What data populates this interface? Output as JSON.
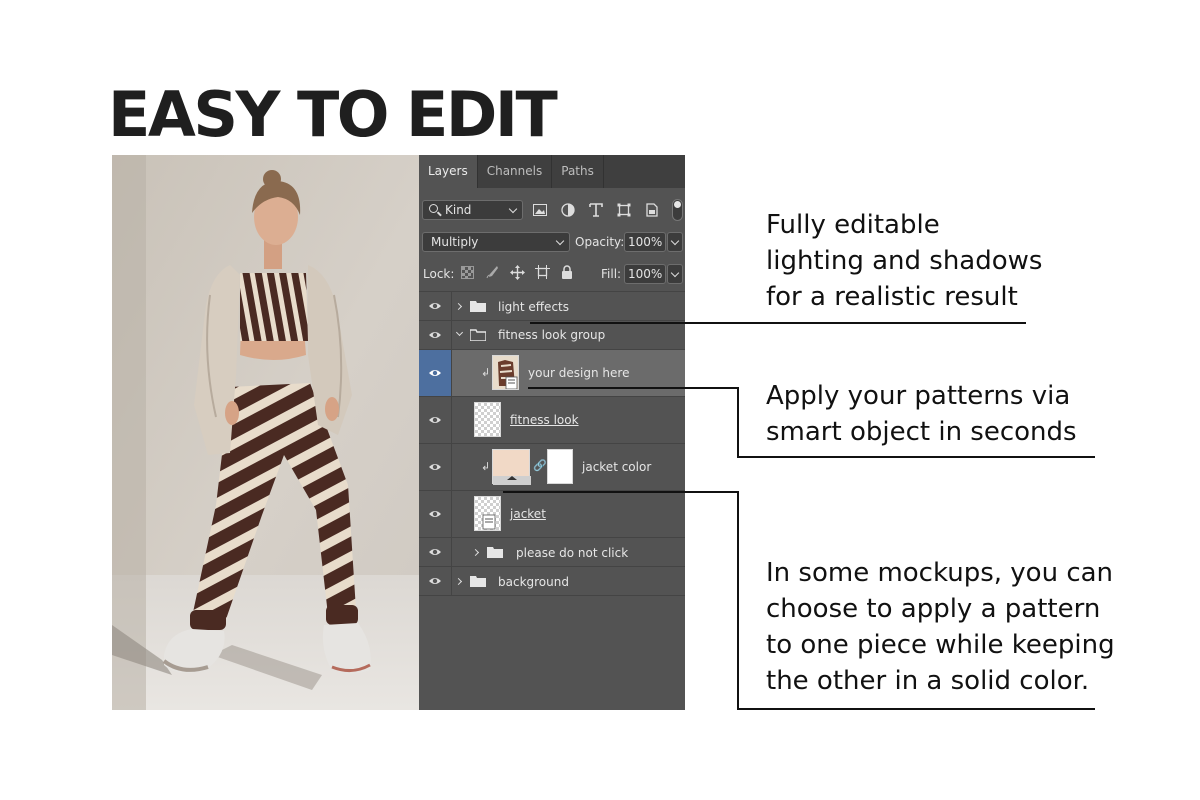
{
  "headline": "EASY TO EDIT",
  "panel": {
    "tabs": [
      "Layers",
      "Channels",
      "Paths"
    ],
    "kind_filter": "Kind",
    "blend_mode": "Multiply",
    "opacity_label": "Opacity:",
    "opacity_value": "100%",
    "lock_label": "Lock:",
    "fill_label": "Fill:",
    "fill_value": "100%",
    "layers": [
      {
        "name": "light effects",
        "type": "group",
        "expanded": false
      },
      {
        "name": "fitness look group",
        "type": "group",
        "expanded": true
      },
      {
        "name": "your design here",
        "type": "smart-object",
        "selected": true,
        "clipped": true
      },
      {
        "name": "fitness look ",
        "type": "layer"
      },
      {
        "name": "jacket color",
        "type": "solid-fill",
        "clipped": true
      },
      {
        "name": "jacket",
        "type": "smart-object"
      },
      {
        "name": "please do not click",
        "type": "group",
        "expanded": false
      },
      {
        "name": "background",
        "type": "group",
        "expanded": false
      }
    ]
  },
  "captions": {
    "lighting": "Fully editable\nlighting and shadows\nfor a realistic result",
    "patterns": "Apply your patterns via\nsmart object in seconds",
    "solid": "In some mockups, you can\nchoose to apply a pattern\nto one piece while keeping\nthe other in a solid color."
  },
  "colors": {
    "panel_bg": "#535353",
    "selection": "#4d6f9f",
    "jacket_color": "#f1d9c6",
    "pattern_dark": "#4a2a22",
    "pattern_light": "#e8dccb"
  }
}
